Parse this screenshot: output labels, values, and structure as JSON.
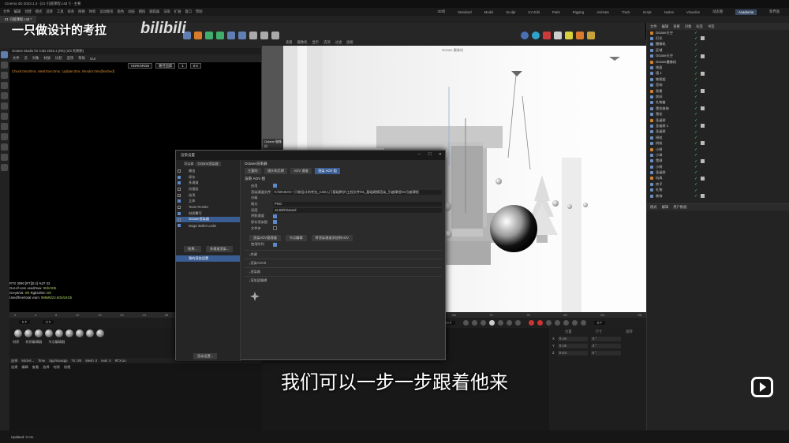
{
  "window": {
    "title": "Cinema 4D 2023.1.3 - [01 引越课程.c4d *] - 主要"
  },
  "menu": [
    "文件",
    "编辑",
    "创建",
    "模式",
    "选择",
    "工具",
    "样条",
    "网格",
    "体积",
    "运动图形",
    "角色",
    "动画",
    "模拟",
    "跟踪器",
    "渲染",
    "扩展",
    "窗口",
    "帮助"
  ],
  "layouts": [
    "3D场",
    "Standard",
    "Model",
    "Sculpt",
    "UV Edit",
    "Paint",
    "Rigging",
    "Animate",
    "Track",
    "Script",
    "Nodes",
    "Visualize",
    "动态图",
    "Academie",
    "新界面"
  ],
  "layout_active": "Academie",
  "doc_tab": "01 引越课程.c4d *",
  "octane_viewer": {
    "title": "Octane Studio for C4D 2022.1 (R5) (3/3 天剩余)",
    "menus": [
      "文件",
      "云",
      "对象",
      "材质",
      "比较",
      "选项",
      "帮助",
      "GUI"
    ],
    "mode": "HDRI/sRGB",
    "render_mode": "路径追踪",
    "value1": "1",
    "value2": "0.6",
    "status": "Check:0ms/0ms. MeshGen:0ms. Update:0ms. Render:0ms(finished)",
    "stats": [
      {
        "k": "RTX 3090 [RT][0.4]",
        "v": "%37  33"
      },
      {
        "k": "Out-of-core used/max:",
        "v": "0Kb/4Gb"
      },
      {
        "k": "Grey8/16:",
        "v": "0/0",
        "k2": "Rgb32/64:",
        "v2": "0/0"
      },
      {
        "k": "Used/free/total vram:",
        "v": "996Mb/22.6Gb/24Gb"
      }
    ]
  },
  "timeline": {
    "start": "0 F",
    "end": "90 F",
    "ticks": [
      "0",
      "2",
      "4",
      "6",
      "8",
      "10",
      "12",
      "14",
      "16",
      "18",
      "20",
      "22",
      "24",
      "26",
      "28",
      "30",
      "32",
      "34",
      "36",
      "38",
      "40",
      "42",
      "44",
      "46",
      "48",
      "50",
      "52",
      "54",
      "56",
      "58",
      "60",
      "62",
      "64",
      "66",
      "68",
      "70",
      "72",
      "74",
      "76",
      "78",
      "80",
      "82",
      "84",
      "86",
      "88",
      "90"
    ]
  },
  "material_tabs": [
    "材质",
    "材质编辑器",
    "节点编辑器"
  ],
  "bottom_left_header": [
    "选择",
    "Michel...",
    "Time",
    "Spp/maxspp",
    "Tri: 0/0",
    "Mesh: 0",
    "Hair: 0",
    "RTX:on"
  ],
  "bottom_left_tabs": [
    "创建",
    "编辑",
    "查看",
    "选择",
    "材质",
    "纹理"
  ],
  "coords": {
    "rows": [
      {
        "axis": "X",
        "pos": "0 cm",
        "rot": "0 °"
      },
      {
        "axis": "Y",
        "pos": "0 cm",
        "rot": "0 °"
      },
      {
        "axis": "Z",
        "pos": "0 cm",
        "rot": "0 °"
      }
    ],
    "h1": "位置",
    "h2": "尺寸",
    "h3": "旋转"
  },
  "viewport": {
    "menus": [
      "查看",
      "摄像机",
      "显示",
      "选项",
      "过滤",
      "面板"
    ],
    "camera": "Octane 摄像机",
    "side_badge": "Octane 摄像机"
  },
  "right_panel": {
    "tabs": [
      "文件",
      "编辑",
      "查看",
      "对象",
      "标签",
      "书签"
    ],
    "objects": [
      "Octane天空",
      "灯光",
      "摄像机",
      "区域",
      "Octane天空",
      "Octane摄像机",
      "地面",
      "墙 1",
      "铁框架",
      "音响",
      "背景",
      "房间",
      "礼物盒",
      "雪花装饰",
      "雪花",
      "圣诞树",
      "圣诞树 1",
      "圣诞树",
      "拐杖",
      "树枝",
      "小树",
      "小球",
      "雪球",
      "小树",
      "圣诞树",
      "玩具",
      "房子",
      "礼物",
      "装饰"
    ],
    "attr_tabs": [
      "模式",
      "编辑",
      "用户数据"
    ]
  },
  "dialog": {
    "title": "渲染设置",
    "renderer_label": "渲染器",
    "renderer": "Octane渲染器",
    "left_items": [
      {
        "label": "输出",
        "cb": false
      },
      {
        "label": "保存",
        "cb": true
      },
      {
        "label": "多通道",
        "cb": true
      },
      {
        "label": "抗锯齿",
        "cb": false
      },
      {
        "label": "选项",
        "cb": false
      },
      {
        "label": "立体",
        "cb": true
      },
      {
        "label": "Team Render",
        "cb": false
      },
      {
        "label": "材质覆写",
        "cb": true
      },
      {
        "label": "Octane渲染器",
        "cb": false,
        "sel": true
      },
      {
        "label": "Magic Bullet Looks",
        "cb": true
      }
    ],
    "effect_button": "效果...",
    "multipass_button": "多通道渲染...",
    "preset": "我的渲染设置",
    "render_setting_button": "渲染设置...",
    "section_title": "Octane渲染器",
    "tabs": [
      "主要的",
      "镜头和后期",
      "AOV 通道",
      "渲染 AOV 组"
    ],
    "tab_active": 3,
    "group_label": "渲染 AOV 组",
    "rows": [
      {
        "label": "启用",
        "type": "check",
        "on": true
      },
      {
        "label": "渲染通道文件",
        "type": "value",
        "value": "K:\\WAIKAI\\一只做设计的考拉_C4D入门基础教学\\工程文件\\01_基础建模渲染_引越课程\\01引越课程"
      },
      {
        "label": "分级",
        "type": "none"
      },
      {
        "label": "格式",
        "type": "value",
        "value": "PNG"
      },
      {
        "label": "深度",
        "type": "value",
        "value": "16 Bit/Channel"
      },
      {
        "label": "阴影通道",
        "type": "check",
        "on": true
      },
      {
        "label": "保存渲染图",
        "type": "check",
        "on": true
      },
      {
        "label": "文件夹",
        "type": "check",
        "on": false
      }
    ],
    "aov_buttons": [
      "渲染AOV管理器",
      "节点编辑",
      "将渲染通道添加到AOV"
    ],
    "use_label": "使用阵列",
    "sections": [
      "关键",
      "渲染AOVS",
      "渲染器",
      "渲染层编辑"
    ]
  },
  "watermark": "一只做设计的考拉",
  "watermark_logo": "bilibili",
  "subtitle": "我们可以一步一步跟着他来",
  "status": "Updated: 0 ms."
}
